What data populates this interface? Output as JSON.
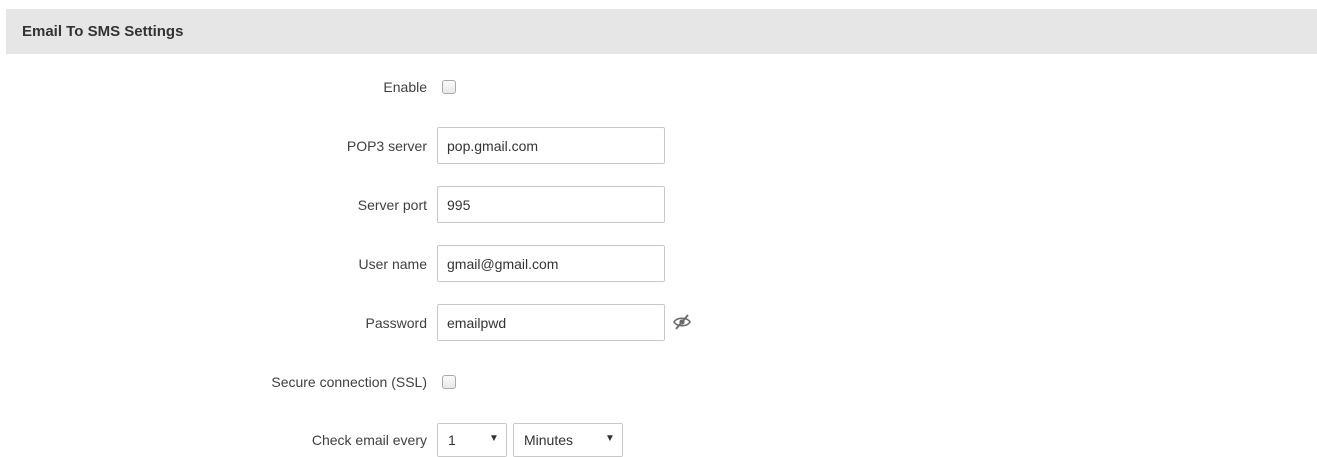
{
  "section": {
    "title": "Email To SMS Settings"
  },
  "fields": {
    "enable": {
      "label": "Enable",
      "checked": false
    },
    "pop3_server": {
      "label": "POP3 server",
      "value": "pop.gmail.com"
    },
    "server_port": {
      "label": "Server port",
      "value": "995"
    },
    "user_name": {
      "label": "User name",
      "value": "gmail@gmail.com"
    },
    "password": {
      "label": "Password",
      "value": "emailpwd",
      "toggle_icon": "eye-slash-icon"
    },
    "secure_connection": {
      "label": "Secure connection (SSL)",
      "checked": false
    },
    "check_email_every": {
      "label": "Check email every",
      "interval_value": "1",
      "unit_value": "Minutes"
    }
  },
  "colors": {
    "header_bg": "#e6e6e6",
    "input_border": "#c8c8c8",
    "text": "#404040"
  }
}
